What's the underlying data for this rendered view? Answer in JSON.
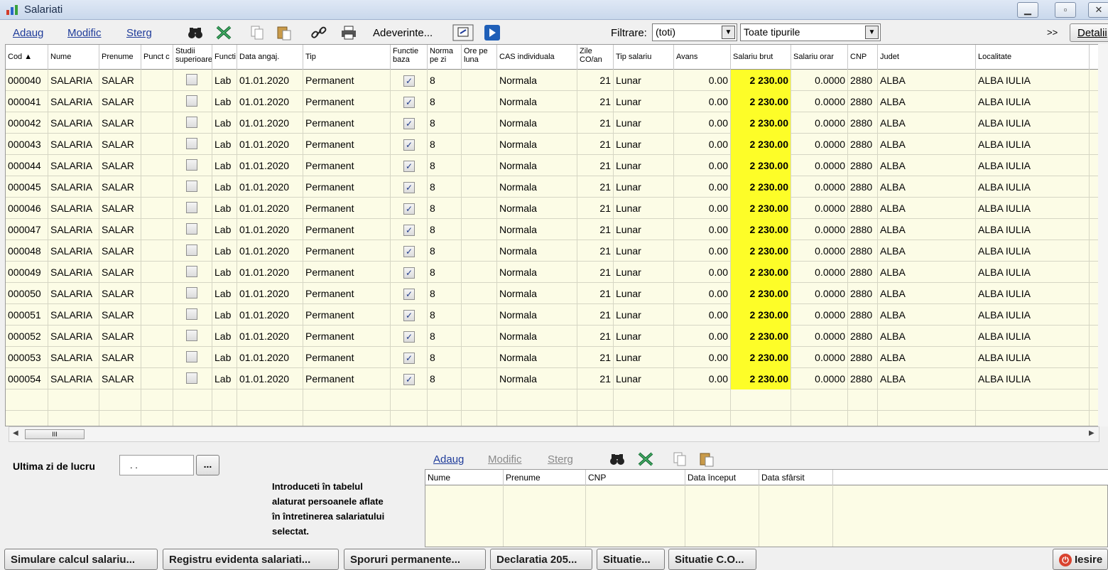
{
  "window": {
    "title": "Salariati"
  },
  "toolbar": {
    "add_label": "Adaug",
    "edit_label": "Modific",
    "delete_label": "Sterg",
    "certificates_label": "Adeverinte...",
    "filter_label": "Filtrare:",
    "filter_value": "(toti)",
    "type_value": "Toate tipurile",
    "more_label": ">>",
    "details_label": "Detalii"
  },
  "grid": {
    "columns": [
      {
        "label": "Cod ▲",
        "lines": 1
      },
      {
        "label": "Nume",
        "lines": 1
      },
      {
        "label": "Prenume",
        "lines": 1
      },
      {
        "label": "Punct c",
        "lines": 1
      },
      {
        "label": "Studii\nsuperioare",
        "lines": 2
      },
      {
        "label": "Functi",
        "lines": 1
      },
      {
        "label": "Data angaj.",
        "lines": 1
      },
      {
        "label": "Tip",
        "lines": 1
      },
      {
        "label": "Functie\nbaza",
        "lines": 2
      },
      {
        "label": "Norma\npe zi",
        "lines": 2
      },
      {
        "label": "Ore pe\nluna",
        "lines": 2
      },
      {
        "label": "CAS individuala",
        "lines": 1
      },
      {
        "label": "Zile\nCO/an",
        "lines": 2
      },
      {
        "label": "Tip salariu",
        "lines": 1
      },
      {
        "label": "Avans",
        "lines": 1
      },
      {
        "label": "Salariu brut",
        "lines": 1
      },
      {
        "label": "Salariu orar",
        "lines": 1
      },
      {
        "label": "CNP",
        "lines": 1
      },
      {
        "label": "Judet",
        "lines": 1
      },
      {
        "label": "Localitate",
        "lines": 1
      }
    ],
    "rows": [
      {
        "cod": "000040",
        "nume": "SALARIA",
        "prenume": "SALAR",
        "functie": "Lab",
        "data": "01.01.2020",
        "tip": "Permanent",
        "norma": "8",
        "cas": "Normala",
        "zile": "21",
        "tip_salariu": "Lunar",
        "avans": "0.00",
        "brut": "2 230.00",
        "orar": "0.0000",
        "cnp": "2880",
        "judet": "ALBA",
        "localitate": "ALBA IULIA"
      },
      {
        "cod": "000041",
        "nume": "SALARIA",
        "prenume": "SALAR",
        "functie": "Lab",
        "data": "01.01.2020",
        "tip": "Permanent",
        "norma": "8",
        "cas": "Normala",
        "zile": "21",
        "tip_salariu": "Lunar",
        "avans": "0.00",
        "brut": "2 230.00",
        "orar": "0.0000",
        "cnp": "2880",
        "judet": "ALBA",
        "localitate": "ALBA IULIA"
      },
      {
        "cod": "000042",
        "nume": "SALARIA",
        "prenume": "SALAR",
        "functie": "Lab",
        "data": "01.01.2020",
        "tip": "Permanent",
        "norma": "8",
        "cas": "Normala",
        "zile": "21",
        "tip_salariu": "Lunar",
        "avans": "0.00",
        "brut": "2 230.00",
        "orar": "0.0000",
        "cnp": "2880",
        "judet": "ALBA",
        "localitate": "ALBA IULIA"
      },
      {
        "cod": "000043",
        "nume": "SALARIA",
        "prenume": "SALAR",
        "functie": "Lab",
        "data": "01.01.2020",
        "tip": "Permanent",
        "norma": "8",
        "cas": "Normala",
        "zile": "21",
        "tip_salariu": "Lunar",
        "avans": "0.00",
        "brut": "2 230.00",
        "orar": "0.0000",
        "cnp": "2880",
        "judet": "ALBA",
        "localitate": "ALBA IULIA"
      },
      {
        "cod": "000044",
        "nume": "SALARIA",
        "prenume": "SALAR",
        "functie": "Lab",
        "data": "01.01.2020",
        "tip": "Permanent",
        "norma": "8",
        "cas": "Normala",
        "zile": "21",
        "tip_salariu": "Lunar",
        "avans": "0.00",
        "brut": "2 230.00",
        "orar": "0.0000",
        "cnp": "2880",
        "judet": "ALBA",
        "localitate": "ALBA IULIA"
      },
      {
        "cod": "000045",
        "nume": "SALARIA",
        "prenume": "SALAR",
        "functie": "Lab",
        "data": "01.01.2020",
        "tip": "Permanent",
        "norma": "8",
        "cas": "Normala",
        "zile": "21",
        "tip_salariu": "Lunar",
        "avans": "0.00",
        "brut": "2 230.00",
        "orar": "0.0000",
        "cnp": "2880",
        "judet": "ALBA",
        "localitate": "ALBA IULIA"
      },
      {
        "cod": "000046",
        "nume": "SALARIA",
        "prenume": "SALAR",
        "functie": "Lab",
        "data": "01.01.2020",
        "tip": "Permanent",
        "norma": "8",
        "cas": "Normala",
        "zile": "21",
        "tip_salariu": "Lunar",
        "avans": "0.00",
        "brut": "2 230.00",
        "orar": "0.0000",
        "cnp": "2880",
        "judet": "ALBA",
        "localitate": "ALBA IULIA"
      },
      {
        "cod": "000047",
        "nume": "SALARIA",
        "prenume": "SALAR",
        "functie": "Lab",
        "data": "01.01.2020",
        "tip": "Permanent",
        "norma": "8",
        "cas": "Normala",
        "zile": "21",
        "tip_salariu": "Lunar",
        "avans": "0.00",
        "brut": "2 230.00",
        "orar": "0.0000",
        "cnp": "2880",
        "judet": "ALBA",
        "localitate": "ALBA IULIA"
      },
      {
        "cod": "000048",
        "nume": "SALARIA",
        "prenume": "SALAR",
        "functie": "Lab",
        "data": "01.01.2020",
        "tip": "Permanent",
        "norma": "8",
        "cas": "Normala",
        "zile": "21",
        "tip_salariu": "Lunar",
        "avans": "0.00",
        "brut": "2 230.00",
        "orar": "0.0000",
        "cnp": "2880",
        "judet": "ALBA",
        "localitate": "ALBA IULIA"
      },
      {
        "cod": "000049",
        "nume": "SALARIA",
        "prenume": "SALAR",
        "functie": "Lab",
        "data": "01.01.2020",
        "tip": "Permanent",
        "norma": "8",
        "cas": "Normala",
        "zile": "21",
        "tip_salariu": "Lunar",
        "avans": "0.00",
        "brut": "2 230.00",
        "orar": "0.0000",
        "cnp": "2880",
        "judet": "ALBA",
        "localitate": "ALBA IULIA"
      },
      {
        "cod": "000050",
        "nume": "SALARIA",
        "prenume": "SALAR",
        "functie": "Lab",
        "data": "01.01.2020",
        "tip": "Permanent",
        "norma": "8",
        "cas": "Normala",
        "zile": "21",
        "tip_salariu": "Lunar",
        "avans": "0.00",
        "brut": "2 230.00",
        "orar": "0.0000",
        "cnp": "2880",
        "judet": "ALBA",
        "localitate": "ALBA IULIA"
      },
      {
        "cod": "000051",
        "nume": "SALARIA",
        "prenume": "SALAR",
        "functie": "Lab",
        "data": "01.01.2020",
        "tip": "Permanent",
        "norma": "8",
        "cas": "Normala",
        "zile": "21",
        "tip_salariu": "Lunar",
        "avans": "0.00",
        "brut": "2 230.00",
        "orar": "0.0000",
        "cnp": "2880",
        "judet": "ALBA",
        "localitate": "ALBA IULIA"
      },
      {
        "cod": "000052",
        "nume": "SALARIA",
        "prenume": "SALAR",
        "functie": "Lab",
        "data": "01.01.2020",
        "tip": "Permanent",
        "norma": "8",
        "cas": "Normala",
        "zile": "21",
        "tip_salariu": "Lunar",
        "avans": "0.00",
        "brut": "2 230.00",
        "orar": "0.0000",
        "cnp": "2880",
        "judet": "ALBA",
        "localitate": "ALBA IULIA"
      },
      {
        "cod": "000053",
        "nume": "SALARIA",
        "prenume": "SALAR",
        "functie": "Lab",
        "data": "01.01.2020",
        "tip": "Permanent",
        "norma": "8",
        "cas": "Normala",
        "zile": "21",
        "tip_salariu": "Lunar",
        "avans": "0.00",
        "brut": "2 230.00",
        "orar": "0.0000",
        "cnp": "2880",
        "judet": "ALBA",
        "localitate": "ALBA IULIA"
      },
      {
        "cod": "000054",
        "nume": "SALARIA",
        "prenume": "SALAR",
        "functie": "Lab",
        "data": "01.01.2020",
        "tip": "Permanent",
        "norma": "8",
        "cas": "Normala",
        "zile": "21",
        "tip_salariu": "Lunar",
        "avans": "0.00",
        "brut": "2 230.00",
        "orar": "0.0000",
        "cnp": "2880",
        "judet": "ALBA",
        "localitate": "ALBA IULIA"
      }
    ],
    "highlight_color": "#fdfd28"
  },
  "bottom": {
    "last_day_label": "Ultima zi de lucru",
    "last_day_value": ". .",
    "ellipsis_label": "...",
    "info_text_lines": [
      "Introduceti în tabelul",
      "alaturat persoanele aflate",
      "în întretinerea salariatului",
      "selectat."
    ],
    "sub_add_label": "Adaug",
    "sub_edit_label": "Modific",
    "sub_delete_label": "Sterg",
    "sub_columns": [
      "Nume",
      "Prenume",
      "CNP",
      "Data început",
      "Data sfârsit"
    ]
  },
  "buttons": {
    "simulare": "Simulare calcul salariu...",
    "registru": "Registru evidenta salariati...",
    "sporuri": "Sporuri permanente...",
    "declaratia": "Declaratia 205...",
    "situatie": "Situatie...",
    "situatie_co": "Situatie C.O...",
    "iesire": "Iesire"
  }
}
